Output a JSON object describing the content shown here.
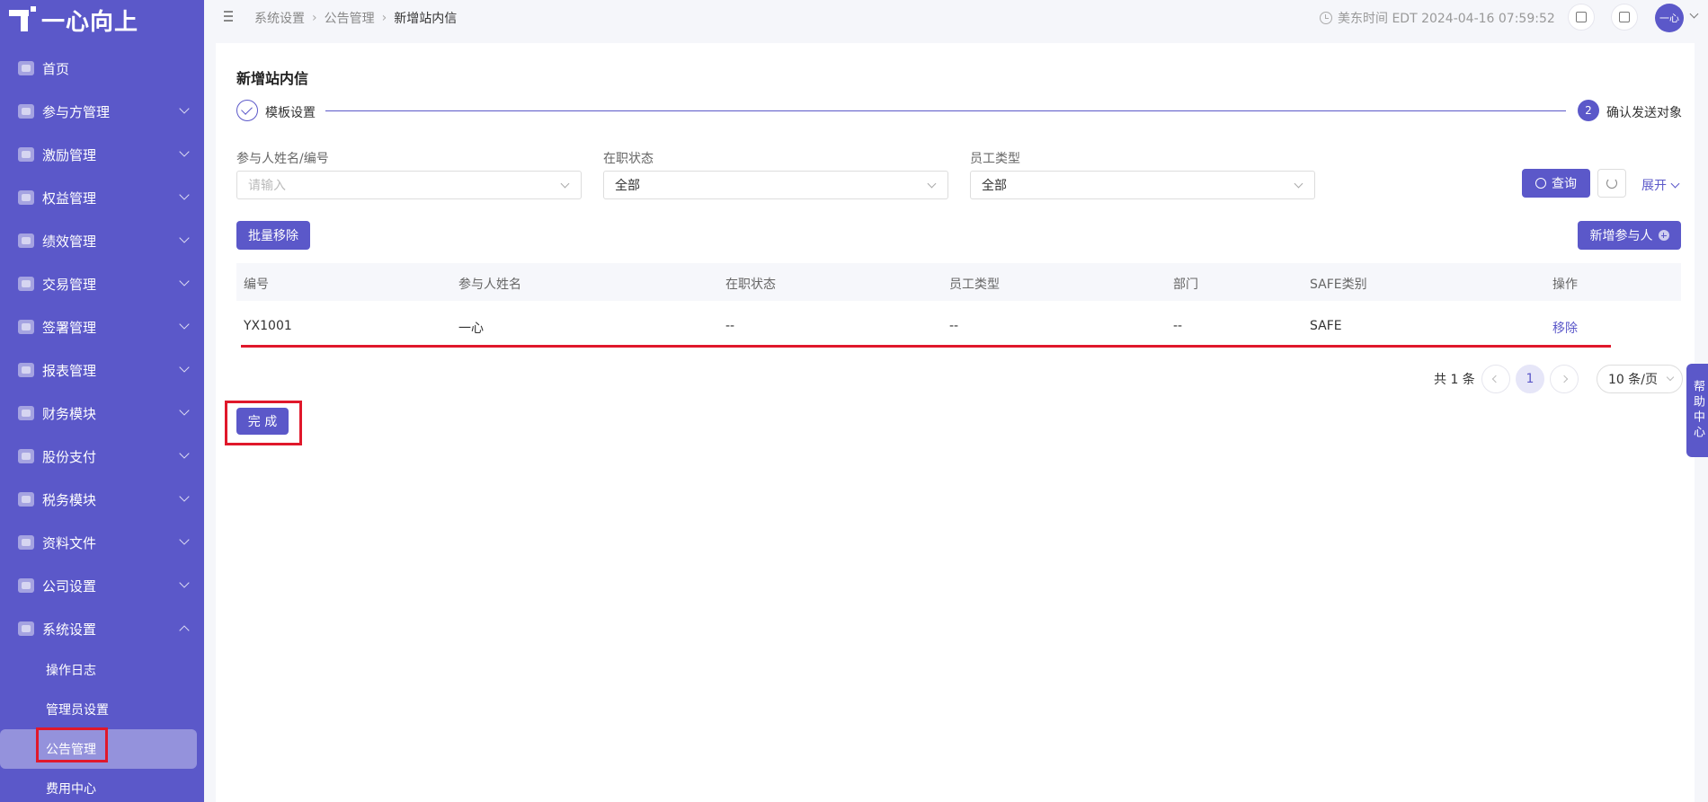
{
  "app": {
    "logo_text": "一心向上"
  },
  "sidebar": {
    "items": [
      {
        "label": "首页",
        "icon": "home-icon"
      },
      {
        "label": "参与方管理",
        "icon": "participant-icon"
      },
      {
        "label": "激励管理",
        "icon": "incentive-icon"
      },
      {
        "label": "权益管理",
        "icon": "equity-icon"
      },
      {
        "label": "绩效管理",
        "icon": "performance-icon"
      },
      {
        "label": "交易管理",
        "icon": "trade-icon"
      },
      {
        "label": "签署管理",
        "icon": "sign-icon"
      },
      {
        "label": "报表管理",
        "icon": "report-icon"
      },
      {
        "label": "财务模块",
        "icon": "finance-icon"
      },
      {
        "label": "股份支付",
        "icon": "share-payment-icon"
      },
      {
        "label": "税务模块",
        "icon": "tax-icon"
      },
      {
        "label": "资料文件",
        "icon": "files-icon"
      },
      {
        "label": "公司设置",
        "icon": "company-icon"
      },
      {
        "label": "系统设置",
        "icon": "system-icon"
      }
    ],
    "sub_items": [
      {
        "label": "操作日志"
      },
      {
        "label": "管理员设置"
      },
      {
        "label": "公告管理"
      },
      {
        "label": "费用中心"
      }
    ]
  },
  "topbar": {
    "breadcrumb": [
      "系统设置",
      "公告管理",
      "新增站内信"
    ],
    "clock_text": "美东时间 EDT 2024-04-16 07:59:52",
    "avatar_text": "一心"
  },
  "page": {
    "title": "新增站内信",
    "steps": [
      {
        "label": "模板设置"
      },
      {
        "number": "2",
        "label": "确认发送对象"
      }
    ]
  },
  "filters": {
    "name": {
      "label": "参与人姓名/编号",
      "placeholder": "请输入"
    },
    "status": {
      "label": "在职状态",
      "value": "全部"
    },
    "type": {
      "label": "员工类型",
      "value": "全部"
    },
    "search_label": "查询",
    "expand_label": "展开"
  },
  "actions": {
    "batch_remove": "批量移除",
    "add_participant": "新增参与人"
  },
  "table": {
    "columns": [
      "编号",
      "参与人姓名",
      "在职状态",
      "员工类型",
      "部门",
      "SAFE类别",
      "操作"
    ],
    "rows": [
      {
        "id": "YX1001",
        "name": "一心",
        "status": "--",
        "type": "--",
        "dept": "--",
        "safe": "SAFE",
        "action": "移除"
      }
    ]
  },
  "pagination": {
    "total": "共 1 条",
    "current": "1",
    "page_size": "10 条/页"
  },
  "footer": {
    "done_label": "完 成"
  },
  "help": {
    "label": "帮助中心"
  },
  "colors": {
    "primary": "#5b58c9",
    "highlight": "#e0182b"
  }
}
